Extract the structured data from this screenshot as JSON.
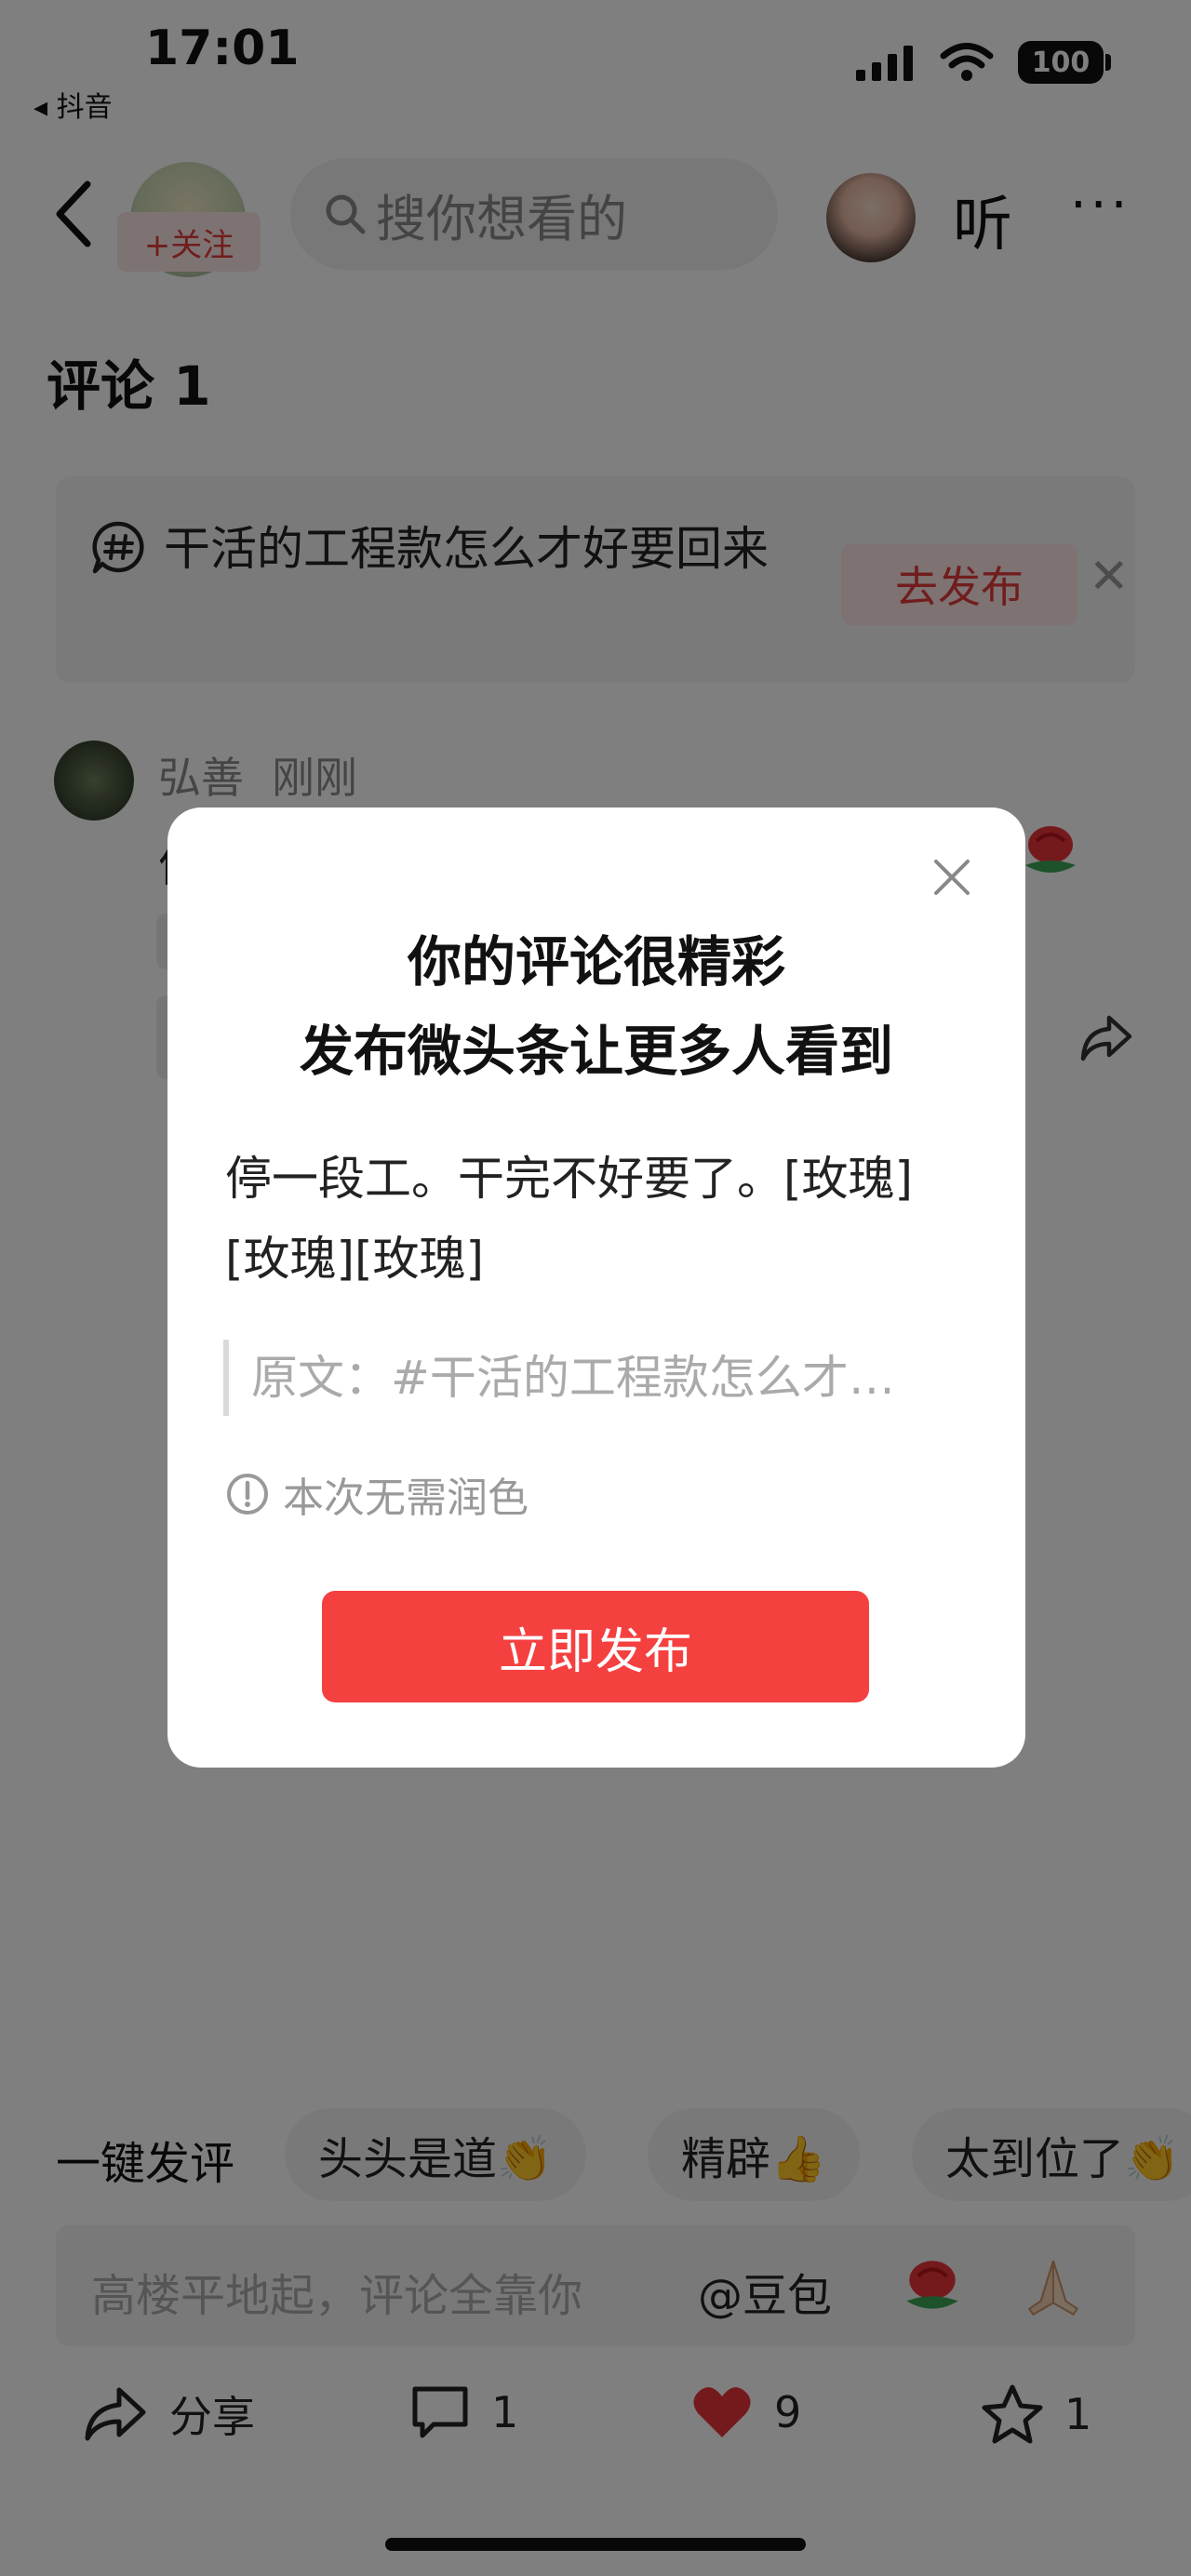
{
  "status_bar": {
    "time": "17:01",
    "back_app": "◂ 抖音",
    "battery": "100"
  },
  "header": {
    "follow_label": "+关注",
    "search_placeholder": "搜你想看的",
    "listen_label": "听",
    "more_label": "···"
  },
  "comments": {
    "title": "评论 1"
  },
  "topic": {
    "text": "干活的工程款怎么才好要回来",
    "publish_label": "去发布",
    "close_label": "✕"
  },
  "comment": {
    "user": "弘善",
    "time": "刚刚",
    "first_char": "停"
  },
  "quick_reactions": {
    "label": "一键发评",
    "chips": [
      "头头是道👏",
      "精辟👍",
      "太到位了👏"
    ]
  },
  "input_bar": {
    "placeholder": "高楼平地起，评论全靠你",
    "at_label": "@豆包"
  },
  "actions": {
    "share_label": "分享",
    "comment_count": "1",
    "like_count": "9",
    "favorite_count": "1"
  },
  "modal": {
    "title_line1": "你的评论很精彩",
    "title_line2": "发布微头条让更多人看到",
    "body": "停一段工。干完不好要了。[玫瑰][玫瑰][玫瑰]",
    "quote": "原文：#干活的工程款怎么才…",
    "note": "本次无需润色",
    "button_label": "立即发布"
  },
  "colors": {
    "accent_red": "#f54040",
    "follow_red": "#e23a3a",
    "overlay": "rgba(0,0,0,0.5)"
  }
}
